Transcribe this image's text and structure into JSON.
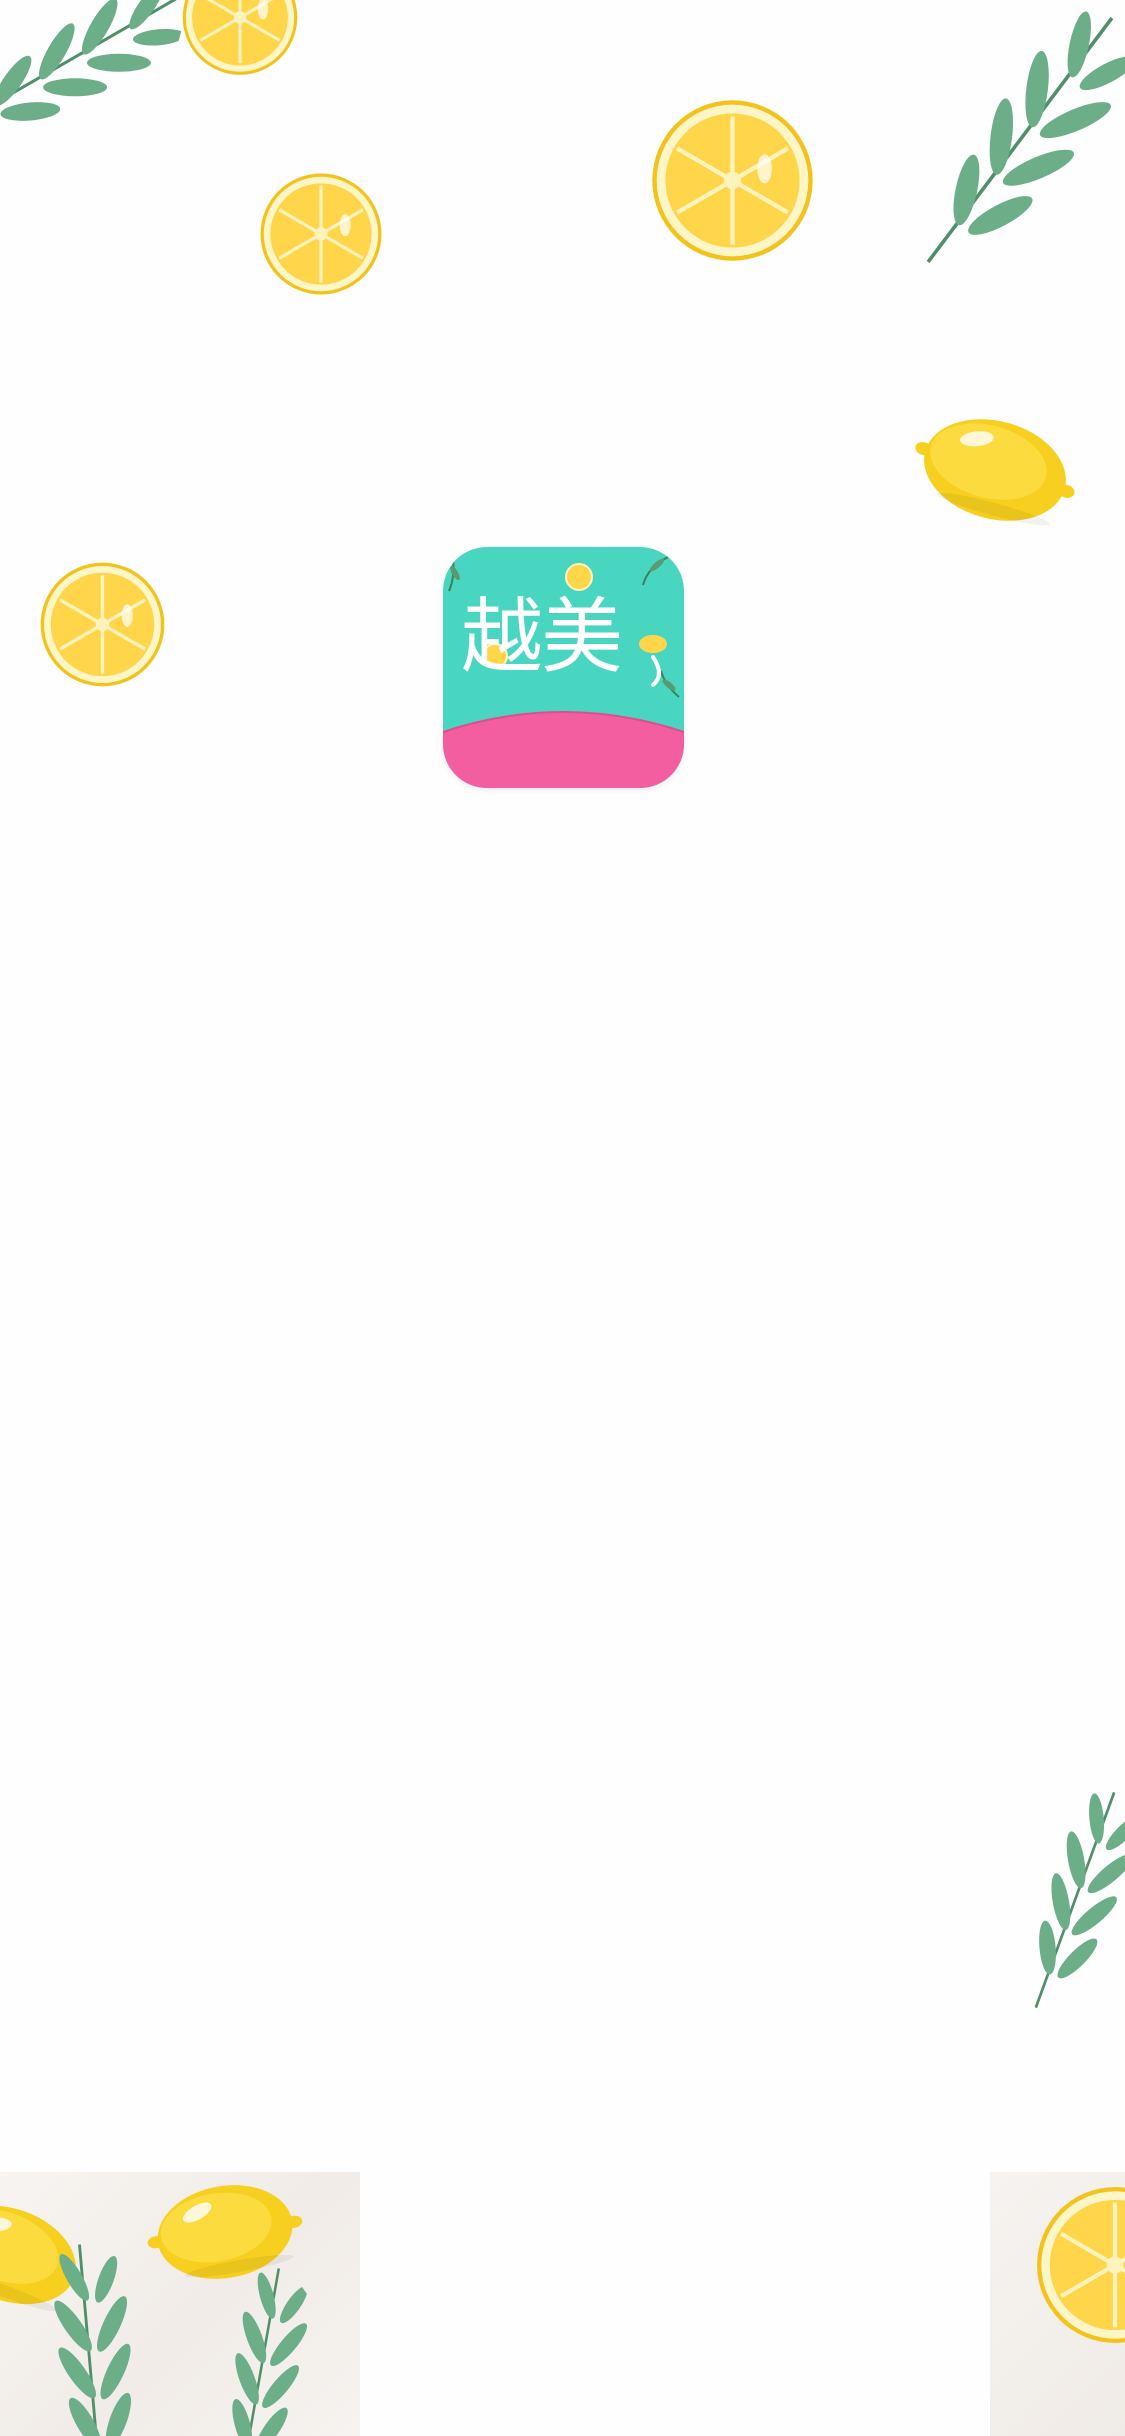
{
  "splash": {
    "app_name": "越美",
    "icon": "yuemei-app-icon"
  },
  "colors": {
    "background": "#fefefe",
    "icon_teal": "#49d6c1",
    "icon_pink": "#f25ea0",
    "lemon_yellow": "#ffd54a",
    "leaf_green": "#5fa77f"
  },
  "decorations": [
    "lemon-slice-icon",
    "whole-lemon-icon",
    "leaf-branch-icon"
  ]
}
